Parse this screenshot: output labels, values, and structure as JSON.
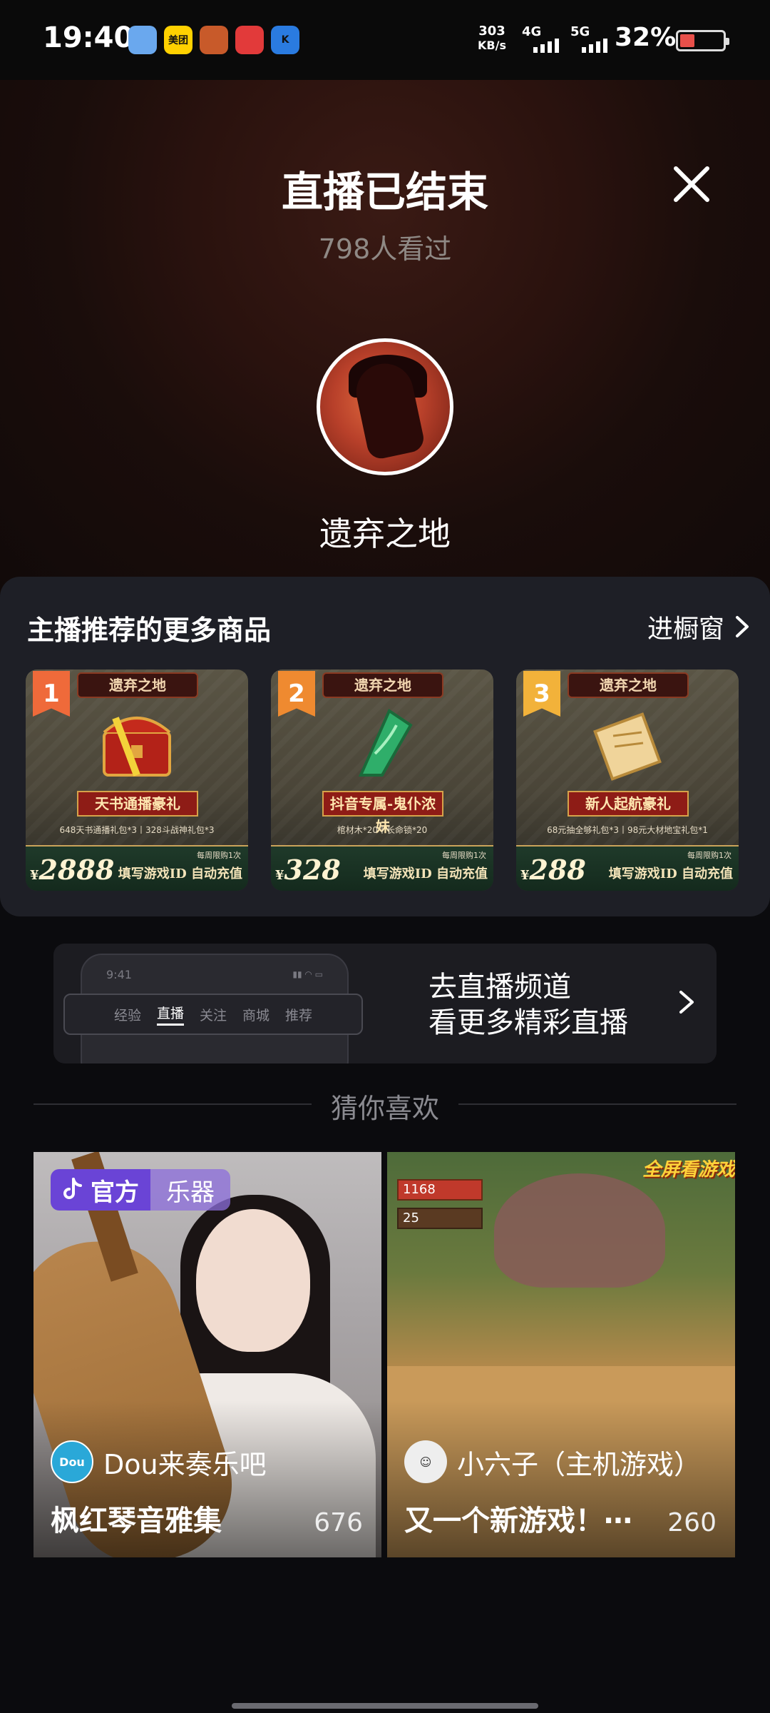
{
  "status_bar": {
    "time": "19:40",
    "net_speed_value": "303",
    "net_speed_unit": "KB/s",
    "sig1": "4G",
    "sig2": "5G",
    "battery": "32%",
    "app_icons": [
      {
        "name": "weather-app-icon",
        "label": "",
        "color": "#6aa8ee"
      },
      {
        "name": "meituan-app-icon",
        "label": "美团",
        "color": "#ffd100"
      },
      {
        "name": "game-app-icon",
        "label": "",
        "color": "#c85a2a"
      },
      {
        "name": "netease-music-app-icon",
        "label": "",
        "color": "#e23a3a"
      },
      {
        "name": "k-app-icon",
        "label": "K",
        "color": "#2a7be0"
      }
    ]
  },
  "header": {
    "title": "直播已结束",
    "viewers": "798人看过",
    "streamer_name": "遗弃之地"
  },
  "products": {
    "title": "主播推荐的更多商品",
    "goto_label": "进橱窗",
    "items": [
      {
        "rank": "1",
        "rank_color": "#ef6a3a",
        "brand": "遗弃之地",
        "name": "天书通播豪礼",
        "desc": "648天书通播礼包*3丨328斗战神礼包*3",
        "price": "2888",
        "limit": "每周限购1次",
        "note": "填写游戏ID 自动充值",
        "art": "chest"
      },
      {
        "rank": "2",
        "rank_color": "#ef8a30",
        "brand": "遗弃之地",
        "name": "抖音专属-鬼仆浓妹",
        "desc": "棺材木*20丨长命锁*20",
        "price": "328",
        "limit": "每周限购1次",
        "note": "填写游戏ID 自动充值",
        "art": "jade"
      },
      {
        "rank": "3",
        "rank_color": "#f2b23a",
        "brand": "遗弃之地",
        "name": "新人起航豪礼",
        "desc": "68元抽全够礼包*3丨98元大材地宝礼包*1",
        "price": "288",
        "limit": "每周限购1次",
        "note": "填写游戏ID 自动充值",
        "art": "scroll"
      }
    ]
  },
  "channel": {
    "line1": "去直播频道",
    "line2": "看更多精彩直播",
    "phone_time": "9:41",
    "tabs": [
      "经验",
      "直播",
      "关注",
      "商城",
      "推荐"
    ],
    "active_tab": "直播"
  },
  "guess": {
    "label": "猜你喜欢",
    "cards": [
      {
        "official_label": "官方",
        "category": "乐器",
        "host": "Dou来奏乐吧",
        "title": "枫红琴音雅集",
        "count": "676"
      },
      {
        "host": "小六子（主机游戏）",
        "title": "又一个新游戏！⋯",
        "count": "260",
        "hp1": "1168",
        "hp2": "25",
        "game_logo": "全屏看游戏"
      }
    ]
  }
}
